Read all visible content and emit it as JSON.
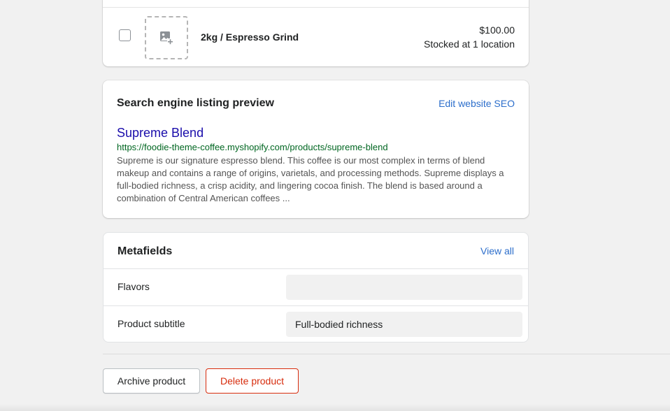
{
  "variant": {
    "name": "2kg / Espresso Grind",
    "price": "$100.00",
    "stock": "Stocked at 1 location",
    "image_icon": "add-image-icon"
  },
  "seo": {
    "heading": "Search engine listing preview",
    "edit_link": "Edit website SEO",
    "title": "Supreme Blend",
    "url": "https://foodie-theme-coffee.myshopify.com/products/supreme-blend",
    "description": "Supreme is our signature espresso blend. This coffee is our most complex in terms of blend makeup and contains a range of origins, varietals, and processing methods. Supreme displays a full-bodied richness, a crisp acidity, and lingering cocoa finish. The blend is based around a combination of Central American coffees ..."
  },
  "metafields": {
    "heading": "Metafields",
    "view_all": "View all",
    "rows": [
      {
        "label": "Flavors",
        "value": ""
      },
      {
        "label": "Product subtitle",
        "value": "Full-bodied richness"
      }
    ]
  },
  "actions": {
    "archive": "Archive product",
    "delete": "Delete product"
  },
  "colors": {
    "link": "#2c6ecb",
    "seo_title": "#1a0dab",
    "seo_url": "#006621",
    "critical": "#d72c0d"
  }
}
